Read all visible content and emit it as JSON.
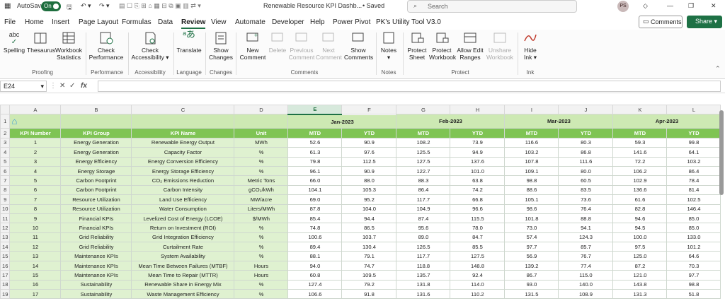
{
  "titlebar": {
    "autosave": "AutoSave",
    "autosave_state": "On",
    "doc_title": "Renewable Resource KPI Dashb...",
    "saved": "• Saved",
    "search_placeholder": "Search",
    "user_initials": "PS"
  },
  "menu": [
    "File",
    "Home",
    "Insert",
    "Page Layout",
    "Formulas",
    "Data",
    "Review",
    "View",
    "Automate",
    "Developer",
    "Help",
    "Power Pivot",
    "PK's Utility Tool V3.0"
  ],
  "menu_active": "Review",
  "buttons": {
    "comments": "Comments",
    "share": "Share"
  },
  "ribbon": {
    "proofing": {
      "spelling": "Spelling",
      "thesaurus": "Thesaurus",
      "workbook_stats": "Workbook Statistics",
      "group": "Proofing"
    },
    "performance": {
      "check_perf": "Check Performance",
      "group": "Performance"
    },
    "accessibility": {
      "check_acc": "Check Accessibility",
      "group": "Accessibility"
    },
    "language": {
      "translate": "Translate",
      "group": "Language"
    },
    "changes": {
      "show_changes": "Show Changes",
      "group": "Changes"
    },
    "comments": {
      "new": "New Comment",
      "delete": "Delete",
      "previous": "Previous Comment",
      "next": "Next Comment",
      "show": "Show Comments",
      "group": "Comments"
    },
    "notes": {
      "notes": "Notes",
      "group": "Notes"
    },
    "protect": {
      "sheet": "Protect Sheet",
      "workbook": "Protect Workbook",
      "allow": "Allow Edit Ranges",
      "unshare": "Unshare Workbook",
      "group": "Protect"
    },
    "ink": {
      "hide": "Hide Ink",
      "group": "Ink"
    }
  },
  "formula_bar": {
    "cell_ref": "E24",
    "fx": "fx",
    "value": ""
  },
  "columns": [
    "A",
    "B",
    "C",
    "D",
    "E",
    "F",
    "G",
    "H",
    "I",
    "J",
    "K",
    "L"
  ],
  "selected_column": "E",
  "months": [
    "Jan-2023",
    "Feb-2023",
    "Mar-2023",
    "Apr-2023"
  ],
  "headers": {
    "kpi_number": "KPI Number",
    "kpi_group": "KPI Group",
    "kpi_name": "KPI Name",
    "unit": "Unit",
    "mtd": "MTD",
    "ytd": "YTD"
  },
  "rows": [
    {
      "r": "3",
      "n": "1",
      "group": "Energy Generation",
      "name": "Renewable Energy Output",
      "unit": "MWh",
      "v": [
        "52.6",
        "90.9",
        "108.2",
        "73.9",
        "116.6",
        "80.3",
        "59.3",
        "99.8"
      ]
    },
    {
      "r": "4",
      "n": "2",
      "group": "Energy Generation",
      "name": "Capacity Factor",
      "unit": "%",
      "v": [
        "61.3",
        "97.6",
        "125.5",
        "94.9",
        "103.2",
        "86.8",
        "141.6",
        "64.1"
      ]
    },
    {
      "r": "5",
      "n": "3",
      "group": "Energy Efficiency",
      "name": "Energy Conversion Efficiency",
      "unit": "%",
      "v": [
        "79.8",
        "112.5",
        "127.5",
        "137.6",
        "107.8",
        "111.6",
        "72.2",
        "103.2"
      ]
    },
    {
      "r": "6",
      "n": "4",
      "group": "Energy Storage",
      "name": "Energy Storage Efficiency",
      "unit": "%",
      "v": [
        "96.1",
        "90.9",
        "122.7",
        "101.0",
        "109.1",
        "80.0",
        "106.2",
        "86.4"
      ]
    },
    {
      "r": "7",
      "n": "5",
      "group": "Carbon Footprint",
      "name": "CO₂ Emissions Reduction",
      "unit": "Metric Tons",
      "v": [
        "66.0",
        "88.0",
        "88.3",
        "63.8",
        "98.8",
        "60.5",
        "102.9",
        "78.4"
      ]
    },
    {
      "r": "8",
      "n": "6",
      "group": "Carbon Footprint",
      "name": "Carbon Intensity",
      "unit": "gCO₂/kWh",
      "v": [
        "104.1",
        "105.3",
        "86.4",
        "74.2",
        "88.6",
        "83.5",
        "136.6",
        "81.4"
      ]
    },
    {
      "r": "9",
      "n": "7",
      "group": "Resource Utilization",
      "name": "Land Use Efficiency",
      "unit": "MW/acre",
      "v": [
        "69.0",
        "95.2",
        "117.7",
        "66.8",
        "105.1",
        "73.6",
        "61.6",
        "102.5"
      ]
    },
    {
      "r": "10",
      "n": "8",
      "group": "Resource Utilization",
      "name": "Water Consumption",
      "unit": "Liters/MWh",
      "v": [
        "87.8",
        "104.0",
        "104.9",
        "96.6",
        "98.6",
        "76.4",
        "82.8",
        "146.4"
      ]
    },
    {
      "r": "11",
      "n": "9",
      "group": "Financial KPIs",
      "name": "Levelized Cost of Energy (LCOE)",
      "unit": "$/MWh",
      "v": [
        "85.4",
        "94.4",
        "87.4",
        "115.5",
        "101.8",
        "88.8",
        "94.6",
        "85.0"
      ]
    },
    {
      "r": "12",
      "n": "10",
      "group": "Financial KPIs",
      "name": "Return on Investment (ROI)",
      "unit": "%",
      "v": [
        "74.8",
        "86.5",
        "95.6",
        "78.0",
        "73.0",
        "94.1",
        "94.5",
        "85.0"
      ]
    },
    {
      "r": "13",
      "n": "11",
      "group": "Grid Reliability",
      "name": "Grid Integration Efficiency",
      "unit": "%",
      "v": [
        "100.6",
        "103.7",
        "89.0",
        "84.7",
        "57.4",
        "124.3",
        "100.0",
        "133.0"
      ]
    },
    {
      "r": "14",
      "n": "12",
      "group": "Grid Reliability",
      "name": "Curtailment Rate",
      "unit": "%",
      "v": [
        "89.4",
        "130.4",
        "126.5",
        "85.5",
        "97.7",
        "85.7",
        "97.5",
        "101.2"
      ]
    },
    {
      "r": "15",
      "n": "13",
      "group": "Maintenance KPIs",
      "name": "System Availability",
      "unit": "%",
      "v": [
        "88.1",
        "79.1",
        "117.7",
        "127.5",
        "56.9",
        "76.7",
        "125.0",
        "64.6"
      ]
    },
    {
      "r": "16",
      "n": "14",
      "group": "Maintenance KPIs",
      "name": "Mean Time Between Failures (MTBF)",
      "unit": "Hours",
      "v": [
        "94.0",
        "74.7",
        "118.8",
        "148.8",
        "139.2",
        "77.4",
        "87.2",
        "70.3"
      ]
    },
    {
      "r": "17",
      "n": "15",
      "group": "Maintenance KPIs",
      "name": "Mean Time to Repair (MTTR)",
      "unit": "Hours",
      "v": [
        "60.8",
        "109.5",
        "135.7",
        "92.4",
        "86.7",
        "115.0",
        "121.0",
        "97.7"
      ]
    },
    {
      "r": "18",
      "n": "16",
      "group": "Sustainability",
      "name": "Renewable Share in Energy Mix",
      "unit": "%",
      "v": [
        "127.4",
        "79.2",
        "131.8",
        "114.0",
        "93.0",
        "140.0",
        "143.8",
        "98.8"
      ]
    },
    {
      "r": "19",
      "n": "17",
      "group": "Sustainability",
      "name": "Waste Management Efficiency",
      "unit": "%",
      "v": [
        "106.6",
        "91.8",
        "131.6",
        "110.2",
        "131.5",
        "108.9",
        "131.3",
        "51.8"
      ]
    }
  ],
  "colors": {
    "accent": "#1e7145",
    "header_green": "#7fc454",
    "light_green": "#dff1d0"
  }
}
